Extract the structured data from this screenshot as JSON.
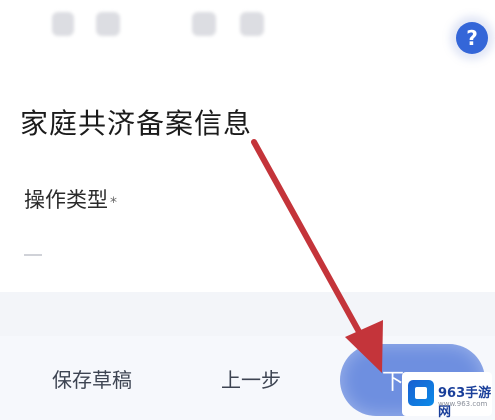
{
  "header": {
    "help_icon": "question-mark-icon",
    "help_label": "?"
  },
  "form": {
    "section_title": "家庭共济备案信息",
    "operation_type": {
      "label": "操作类型",
      "required_mark": "*",
      "value": ""
    }
  },
  "bottom_bar": {
    "save_draft_label": "保存草稿",
    "previous_label": "上一步",
    "next_label": "下一"
  },
  "annotation": {
    "arrow_color": "#c4343a"
  },
  "watermark": {
    "brand": "963手游网",
    "sub": "www.963.com"
  },
  "colors": {
    "accent": "#3466d8",
    "next_button": "#6e8fe0"
  }
}
